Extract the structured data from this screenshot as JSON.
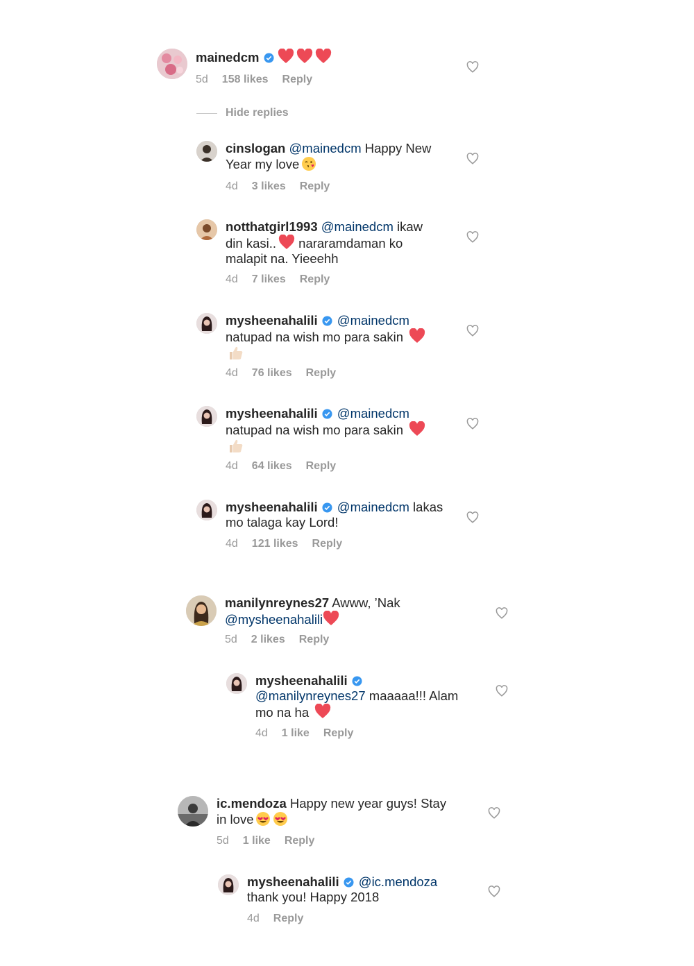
{
  "comments": [
    {
      "username": "mainedcm",
      "text_before": "",
      "mention": "",
      "text": "",
      "hearts": 3,
      "time": "5d",
      "likes": "158 likes",
      "reply": "Reply"
    },
    {
      "username": "cinslogan",
      "mention": "@mainedcm",
      "text1": " Happy New",
      "text2": "Year my love",
      "time": "4d",
      "likes": "3 likes",
      "reply": "Reply"
    },
    {
      "username": "notthatgirl1993",
      "mention": "@mainedcm",
      "text1": " ikaw",
      "text2": "din kasi..",
      "text2b": " nararamdaman ko",
      "text3": "malapit na. Yieeehh",
      "time": "4d",
      "likes": "7 likes",
      "reply": "Reply"
    },
    {
      "username": "mysheenahalili",
      "mention": "@mainedcm",
      "text2": "natupad na wish mo para sakin",
      "time": "4d",
      "likes": "76 likes",
      "reply": "Reply"
    },
    {
      "username": "mysheenahalili",
      "mention": "@mainedcm",
      "text2": "natupad na wish mo para sakin",
      "time": "4d",
      "likes": "64 likes",
      "reply": "Reply"
    },
    {
      "username": "mysheenahalili",
      "mention": "@mainedcm",
      "text1": " lakas",
      "text2": "mo talaga kay Lord!",
      "time": "4d",
      "likes": "121 likes",
      "reply": "Reply"
    },
    {
      "username": "manilynreynes27",
      "text1": " Awww, ’Nak",
      "mention2": "@mysheenahalili",
      "time": "5d",
      "likes": "2 likes",
      "reply": "Reply"
    },
    {
      "username": "mysheenahalili",
      "mention2": "@manilynreynes27",
      "text2": " maaaaa!!! Alam",
      "text3": "mo na ha",
      "time": "4d",
      "likes": "1 like",
      "reply": "Reply"
    },
    {
      "username": "ic.mendoza",
      "text1": " Happy new year guys! Stay",
      "text2": "in love",
      "time": "5d",
      "likes": "1 like",
      "reply": "Reply"
    },
    {
      "username": "mysheenahalili",
      "mention": "@ic.mendoza",
      "text2": "thank you! Happy 2018",
      "time": "4d",
      "reply": "Reply"
    }
  ],
  "hide_replies": "Hide replies",
  "colors": {
    "text": "#262626",
    "mention": "#003569",
    "meta": "#999999",
    "verified": "#3897f0",
    "heart": "#ed4956"
  },
  "icons": {
    "like": "heart-outline-icon",
    "verified": "verified-badge-icon",
    "heart_emoji": "red-heart-emoji",
    "kiss_emoji": "face-blowing-kiss-emoji",
    "thumbs_emoji": "thumbs-up-emoji",
    "hearteyes_emoji": "heart-eyes-emoji"
  }
}
